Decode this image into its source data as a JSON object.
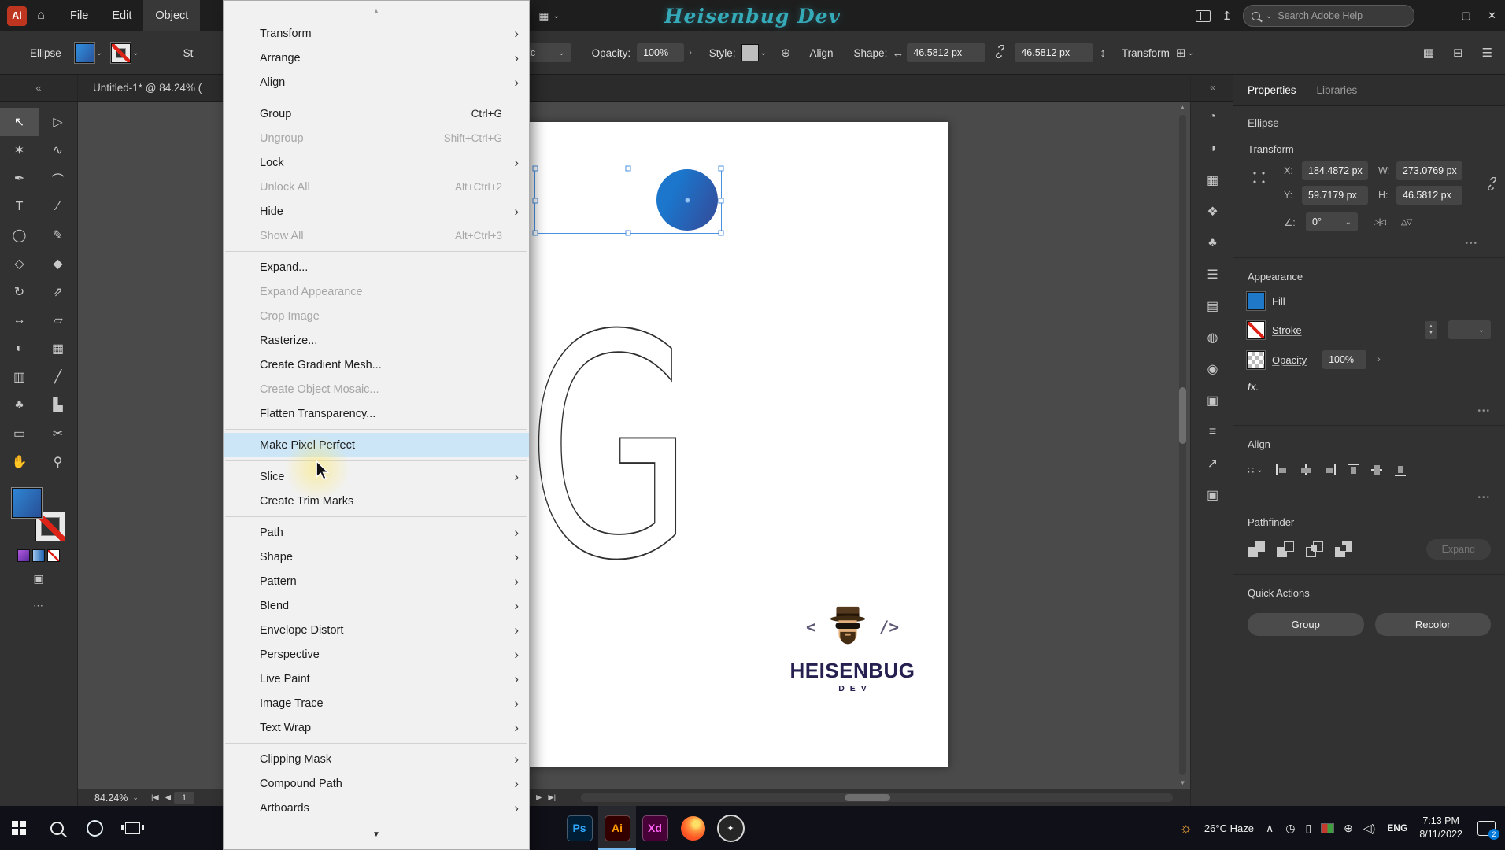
{
  "menubar": {
    "app_icon": "Ai",
    "items": [
      "File",
      "Edit",
      "Object"
    ],
    "open_menu": "Object",
    "title": "Heisenbug Dev",
    "search_placeholder": "Search Adobe Help"
  },
  "icons": {
    "home": "⌂",
    "chevron_down": "⌄",
    "submenu_arrow": "›",
    "minimize": "—",
    "restore": "▢",
    "close": "✕",
    "workspace": "▦",
    "share": "↥",
    "grid": "▦",
    "panel_columns": "⊟",
    "hamburger": "☰",
    "globe": "⊕",
    "width_arrows": "↔",
    "height_arrows": "↕",
    "transform_grid": "⊞",
    "collapse_left": "«",
    "collapse_right": "«",
    "menu_scroll_up": "▲",
    "menu_scroll_down": "▼",
    "dots": "•••",
    "ellipsis": "⋯",
    "draw_modes": "▣",
    "scroll_up": "▲",
    "scroll_down": "▼",
    "nav_first": "|◀",
    "nav_prev": "◀",
    "nav_next": "▶",
    "nav_last": "▶|",
    "angle": "∠:",
    "flip_h": "▷|◁",
    "flip_v": "△▽",
    "stepper_up": "▲",
    "stepper_down": "▼",
    "opacity_chevron": "›",
    "align_to": "∷",
    "weather": "☼",
    "tray_expand": "∧"
  },
  "control_bar": {
    "selection_label": "Ellipse",
    "stroke_label": "St",
    "brush_value": "Basic",
    "opacity_label": "Opacity:",
    "opacity_value": "100%",
    "style_label": "Style:",
    "align_label": "Align",
    "shape_label": "Shape:",
    "shape_width": "46.5812 px",
    "shape_height": "46.5812 px",
    "transform_label": "Transform"
  },
  "object_menu": {
    "items": [
      {
        "label": "Transform",
        "submenu": true
      },
      {
        "label": "Arrange",
        "submenu": true
      },
      {
        "label": "Align",
        "submenu": true
      },
      {
        "sep": true
      },
      {
        "label": "Group",
        "shortcut": "Ctrl+G"
      },
      {
        "label": "Ungroup",
        "shortcut": "Shift+Ctrl+G",
        "disabled": true
      },
      {
        "label": "Lock",
        "submenu": true
      },
      {
        "label": "Unlock All",
        "shortcut": "Alt+Ctrl+2",
        "disabled": true
      },
      {
        "label": "Hide",
        "submenu": true
      },
      {
        "label": "Show All",
        "shortcut": "Alt+Ctrl+3",
        "disabled": true
      },
      {
        "sep": true
      },
      {
        "label": "Expand..."
      },
      {
        "label": "Expand Appearance",
        "disabled": true
      },
      {
        "label": "Crop Image",
        "disabled": true
      },
      {
        "label": "Rasterize..."
      },
      {
        "label": "Create Gradient Mesh..."
      },
      {
        "label": "Create Object Mosaic...",
        "disabled": true
      },
      {
        "label": "Flatten Transparency..."
      },
      {
        "sep": true
      },
      {
        "label": "Make Pixel Perfect",
        "highlight": true
      },
      {
        "sep": true
      },
      {
        "label": "Slice",
        "submenu": true
      },
      {
        "label": "Create Trim Marks"
      },
      {
        "sep": true
      },
      {
        "label": "Path",
        "submenu": true
      },
      {
        "label": "Shape",
        "submenu": true
      },
      {
        "label": "Pattern",
        "submenu": true
      },
      {
        "label": "Blend",
        "submenu": true
      },
      {
        "label": "Envelope Distort",
        "submenu": true
      },
      {
        "label": "Perspective",
        "submenu": true
      },
      {
        "label": "Live Paint",
        "submenu": true
      },
      {
        "label": "Image Trace",
        "submenu": true
      },
      {
        "label": "Text Wrap",
        "submenu": true
      },
      {
        "sep": true
      },
      {
        "label": "Clipping Mask",
        "submenu": true
      },
      {
        "label": "Compound Path",
        "submenu": true
      },
      {
        "label": "Artboards",
        "submenu": true
      }
    ]
  },
  "toolbar": {
    "tools": [
      {
        "name": "selection-tool",
        "glyph": "↖",
        "active": true
      },
      {
        "name": "direct-selection-tool",
        "glyph": "▷"
      },
      {
        "name": "magic-wand-tool",
        "glyph": "✶"
      },
      {
        "name": "lasso-tool",
        "glyph": "∿"
      },
      {
        "name": "pen-tool",
        "glyph": "✒"
      },
      {
        "name": "curvature-tool",
        "glyph": "⌒"
      },
      {
        "name": "type-tool",
        "glyph": "T"
      },
      {
        "name": "line-segment-tool",
        "glyph": "∕"
      },
      {
        "name": "ellipse-tool",
        "glyph": "◯"
      },
      {
        "name": "paintbrush-tool",
        "glyph": "✎"
      },
      {
        "name": "shape-builder-tool",
        "glyph": "◇"
      },
      {
        "name": "eraser-tool",
        "glyph": "◆"
      },
      {
        "name": "rotate-tool",
        "glyph": "↻"
      },
      {
        "name": "scale-tool",
        "glyph": "⇗"
      },
      {
        "name": "width-tool",
        "glyph": "↔"
      },
      {
        "name": "free-transform-tool",
        "glyph": "▱"
      },
      {
        "name": "blend-tool",
        "glyph": "◐"
      },
      {
        "name": "mesh-tool",
        "glyph": "▦"
      },
      {
        "name": "gradient-tool",
        "glyph": "▥"
      },
      {
        "name": "eyedropper-tool",
        "glyph": "╱"
      },
      {
        "name": "symbol-sprayer-tool",
        "glyph": "♣"
      },
      {
        "name": "column-graph-tool",
        "glyph": "▙"
      },
      {
        "name": "artboard-tool",
        "glyph": "▭"
      },
      {
        "name": "slice-tool",
        "glyph": "✂"
      },
      {
        "name": "hand-tool",
        "glyph": "✋"
      },
      {
        "name": "zoom-tool",
        "glyph": "⚲"
      }
    ]
  },
  "document": {
    "tab_title": "Untitled-1* @ 84.24% (",
    "zoom_value": "84.24%",
    "artboard_number": "1",
    "artboard_letter": "G",
    "logo": {
      "bracket_left": "<",
      "bracket_right": "/>",
      "brand": "HEISENBUG",
      "sub": "DEV"
    }
  },
  "panel_strip": {
    "icons": [
      {
        "name": "color-panel-icon",
        "glyph": "◔"
      },
      {
        "name": "color-guide-panel-icon",
        "glyph": "◑"
      },
      {
        "name": "swatches-panel-icon",
        "glyph": "▦"
      },
      {
        "name": "brushes-panel-icon",
        "glyph": "❖"
      },
      {
        "name": "symbols-panel-icon",
        "glyph": "♣"
      },
      {
        "name": "stroke-panel-icon",
        "glyph": "☰"
      },
      {
        "name": "gradient-panel-icon",
        "glyph": "▤"
      },
      {
        "name": "transparency-panel-icon",
        "glyph": "◍"
      },
      {
        "name": "appearance-panel-icon",
        "glyph": "◉"
      },
      {
        "name": "graphic-styles-panel-icon",
        "glyph": "▣"
      },
      {
        "name": "layers-panel-icon",
        "glyph": "≡"
      },
      {
        "name": "asset-export-panel-icon",
        "glyph": "↗"
      },
      {
        "name": "artboards-panel-icon",
        "glyph": "▣"
      }
    ]
  },
  "properties": {
    "tabs": [
      {
        "label": "Properties",
        "active": true
      },
      {
        "label": "Libraries",
        "active": false
      }
    ],
    "object_type": "Ellipse",
    "transform": {
      "header": "Transform",
      "x_label": "X:",
      "x_value": "184.4872 px",
      "y_label": "Y:",
      "y_value": "59.7179 px",
      "w_label": "W:",
      "w_value": "273.0769 px",
      "h_label": "H:",
      "h_value": "46.5812 px",
      "angle_value": "0°"
    },
    "appearance": {
      "header": "Appearance",
      "fill_label": "Fill",
      "stroke_label": "Stroke",
      "opacity_label": "Opacity",
      "opacity_value": "100%",
      "fx_label": "fx."
    },
    "align": {
      "header": "Align",
      "icons": [
        "horizontal-align-left",
        "horizontal-align-center",
        "horizontal-align-right",
        "vertical-align-top",
        "vertical-align-center",
        "vertical-align-bottom"
      ]
    },
    "pathfinder": {
      "header": "Pathfinder",
      "icons": [
        "unite",
        "minus-front",
        "intersect",
        "exclude"
      ],
      "expand_label": "Expand"
    },
    "quick_actions": {
      "header": "Quick Actions",
      "buttons": [
        "Group",
        "Recolor"
      ]
    }
  },
  "taskbar": {
    "apps": [
      {
        "name": "photoshop",
        "label": "Ps",
        "bg": "#001e36",
        "fg": "#31a8ff"
      },
      {
        "name": "illustrator",
        "label": "Ai",
        "bg": "#330000",
        "fg": "#ff9a00",
        "active": true
      },
      {
        "name": "adobe-xd",
        "label": "Xd",
        "bg": "#470137",
        "fg": "#ff61f6"
      },
      {
        "name": "firefox",
        "type": "firefox"
      },
      {
        "name": "media-app",
        "type": "circle",
        "glyph": "✦"
      }
    ],
    "tray": [
      {
        "name": "clock-icon",
        "glyph": "◷"
      },
      {
        "name": "power-icon",
        "glyph": "▯"
      },
      {
        "name": "language-flag-icon",
        "swatch": true
      },
      {
        "name": "network-globe-icon",
        "glyph": "⊕"
      },
      {
        "name": "volume-icon",
        "glyph": "◁)"
      }
    ],
    "weather": "26°C Haze",
    "language": "ENG",
    "time": "7:13 PM",
    "date": "8/11/2022",
    "notification_badge": "2"
  },
  "colors": {
    "selection_blue": "#4a90e2",
    "title_teal": "#35aab8",
    "brand_navy": "#262050",
    "menu_highlight": "#cde6f7",
    "fill_blue": "#1f78c8",
    "stroke_red": "#dd2218"
  }
}
